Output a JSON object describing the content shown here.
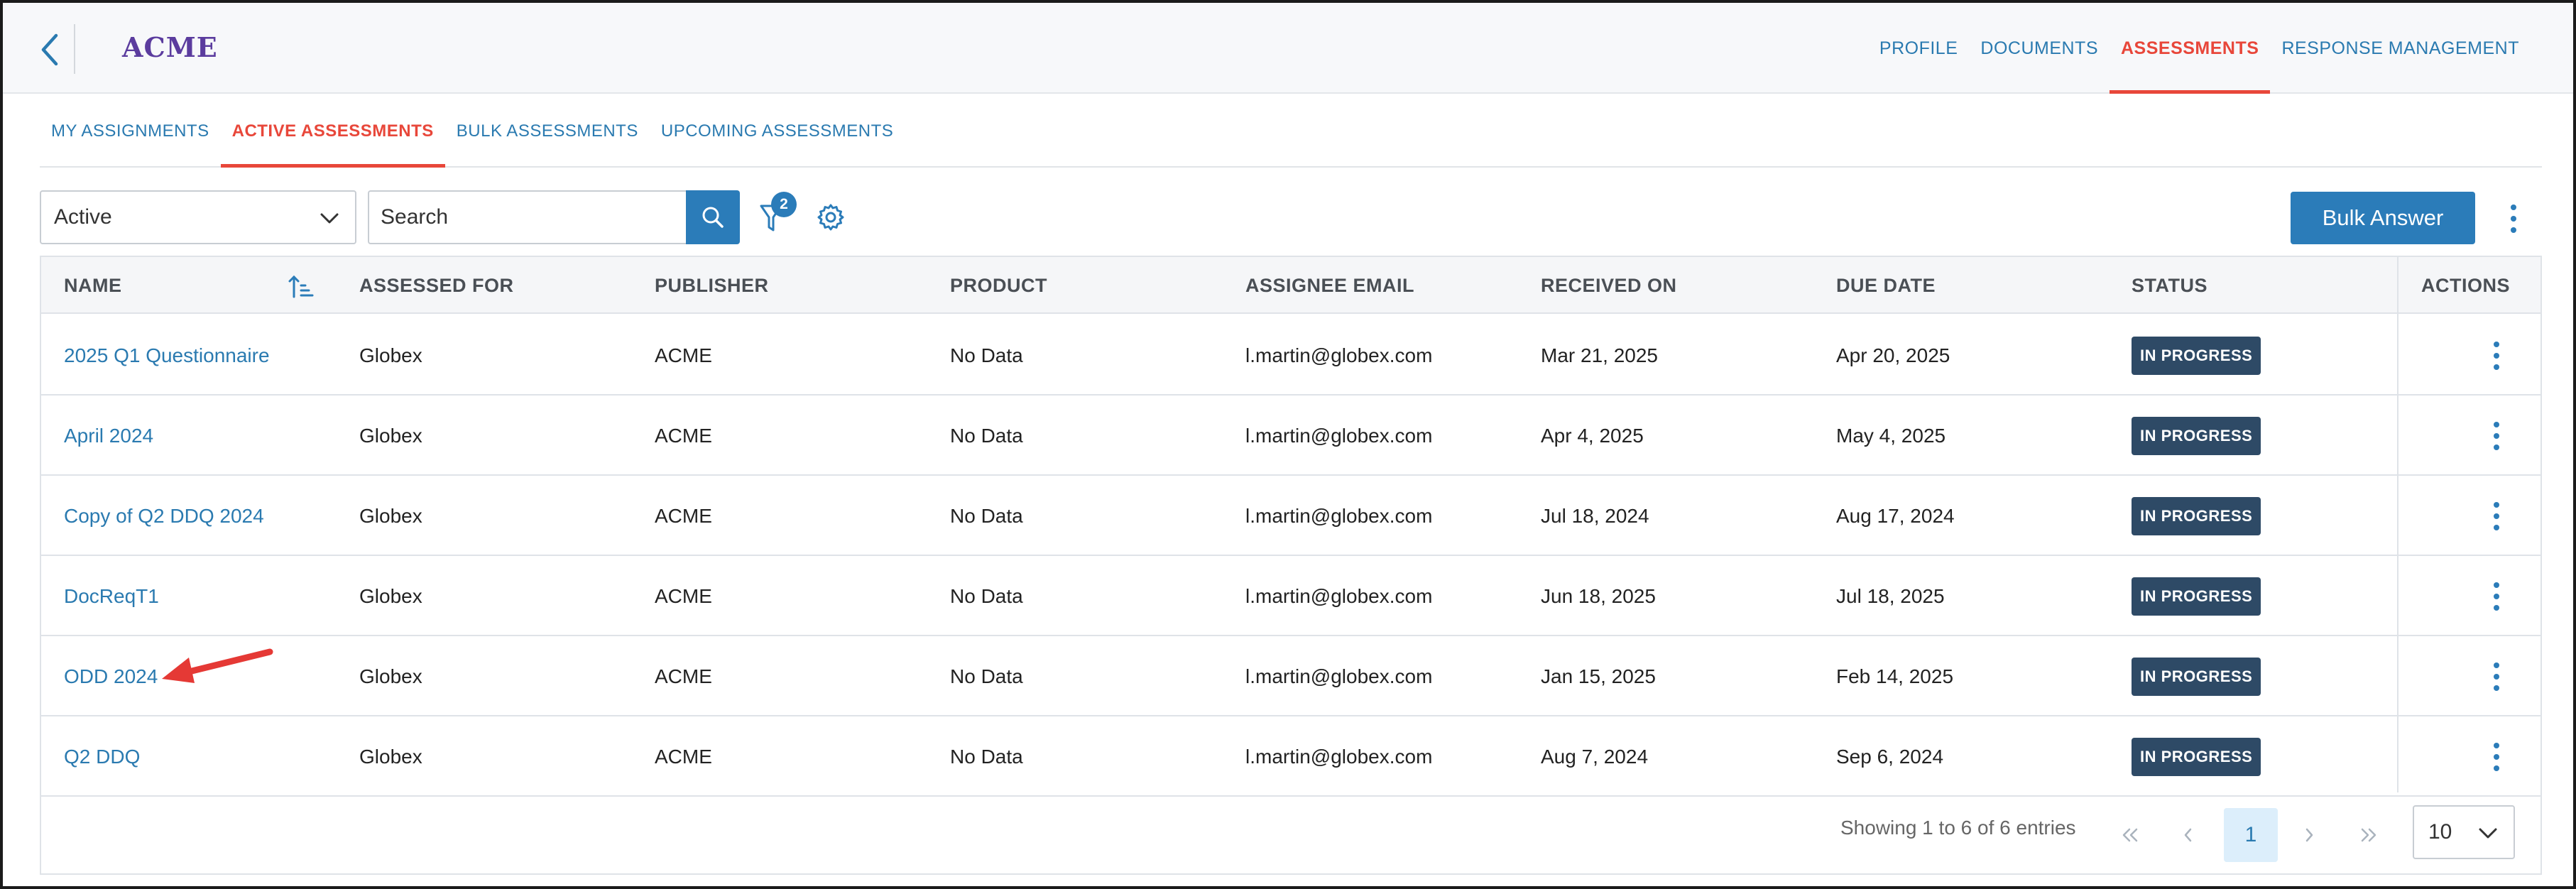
{
  "header": {
    "logo": "ACME",
    "nav": [
      {
        "label": "PROFILE",
        "active": false
      },
      {
        "label": "DOCUMENTS",
        "active": false
      },
      {
        "label": "ASSESSMENTS",
        "active": true
      },
      {
        "label": "RESPONSE MANAGEMENT",
        "active": false
      }
    ]
  },
  "subtabs": [
    {
      "label": "MY ASSIGNMENTS",
      "active": false
    },
    {
      "label": "ACTIVE ASSESSMENTS",
      "active": true
    },
    {
      "label": "BULK ASSESSMENTS",
      "active": false
    },
    {
      "label": "UPCOMING ASSESSMENTS",
      "active": false
    }
  ],
  "toolbar": {
    "status_value": "Active",
    "search_placeholder": "Search",
    "filter_count": "2",
    "bulk_answer_label": "Bulk Answer"
  },
  "table": {
    "columns": [
      "NAME",
      "ASSESSED FOR",
      "PUBLISHER",
      "PRODUCT",
      "ASSIGNEE EMAIL",
      "RECEIVED ON",
      "DUE DATE",
      "STATUS",
      "ACTIONS"
    ],
    "rows": [
      {
        "name": "2025 Q1 Questionnaire",
        "assessed_for": "Globex",
        "publisher": "ACME",
        "product": "No Data",
        "email": "l.martin@globex.com",
        "received": "Mar 21, 2025",
        "due": "Apr 20, 2025",
        "status": "IN PROGRESS"
      },
      {
        "name": "April 2024",
        "assessed_for": "Globex",
        "publisher": "ACME",
        "product": "No Data",
        "email": "l.martin@globex.com",
        "received": "Apr 4, 2025",
        "due": "May 4, 2025",
        "status": "IN PROGRESS"
      },
      {
        "name": "Copy of Q2 DDQ 2024",
        "assessed_for": "Globex",
        "publisher": "ACME",
        "product": "No Data",
        "email": "l.martin@globex.com",
        "received": "Jul 18, 2024",
        "due": "Aug 17, 2024",
        "status": "IN PROGRESS"
      },
      {
        "name": "DocReqT1",
        "assessed_for": "Globex",
        "publisher": "ACME",
        "product": "No Data",
        "email": "l.martin@globex.com",
        "received": "Jun 18, 2025",
        "due": "Jul 18, 2025",
        "status": "IN PROGRESS"
      },
      {
        "name": "ODD 2024",
        "assessed_for": "Globex",
        "publisher": "ACME",
        "product": "No Data",
        "email": "l.martin@globex.com",
        "received": "Jan 15, 2025",
        "due": "Feb 14, 2025",
        "status": "IN PROGRESS"
      },
      {
        "name": "Q2 DDQ",
        "assessed_for": "Globex",
        "publisher": "ACME",
        "product": "No Data",
        "email": "l.martin@globex.com",
        "received": "Aug 7, 2024",
        "due": "Sep 6, 2024",
        "status": "IN PROGRESS"
      }
    ]
  },
  "pagination": {
    "entries_text": "Showing 1 to 6 of 6 entries",
    "current_page": "1",
    "page_size": "10"
  },
  "colors": {
    "accent": "#2b7cb9",
    "active_tab": "#e8473a",
    "badge": "#2e4a66",
    "logo": "#5b3c9e",
    "annotation_arrow": "#e53935"
  }
}
